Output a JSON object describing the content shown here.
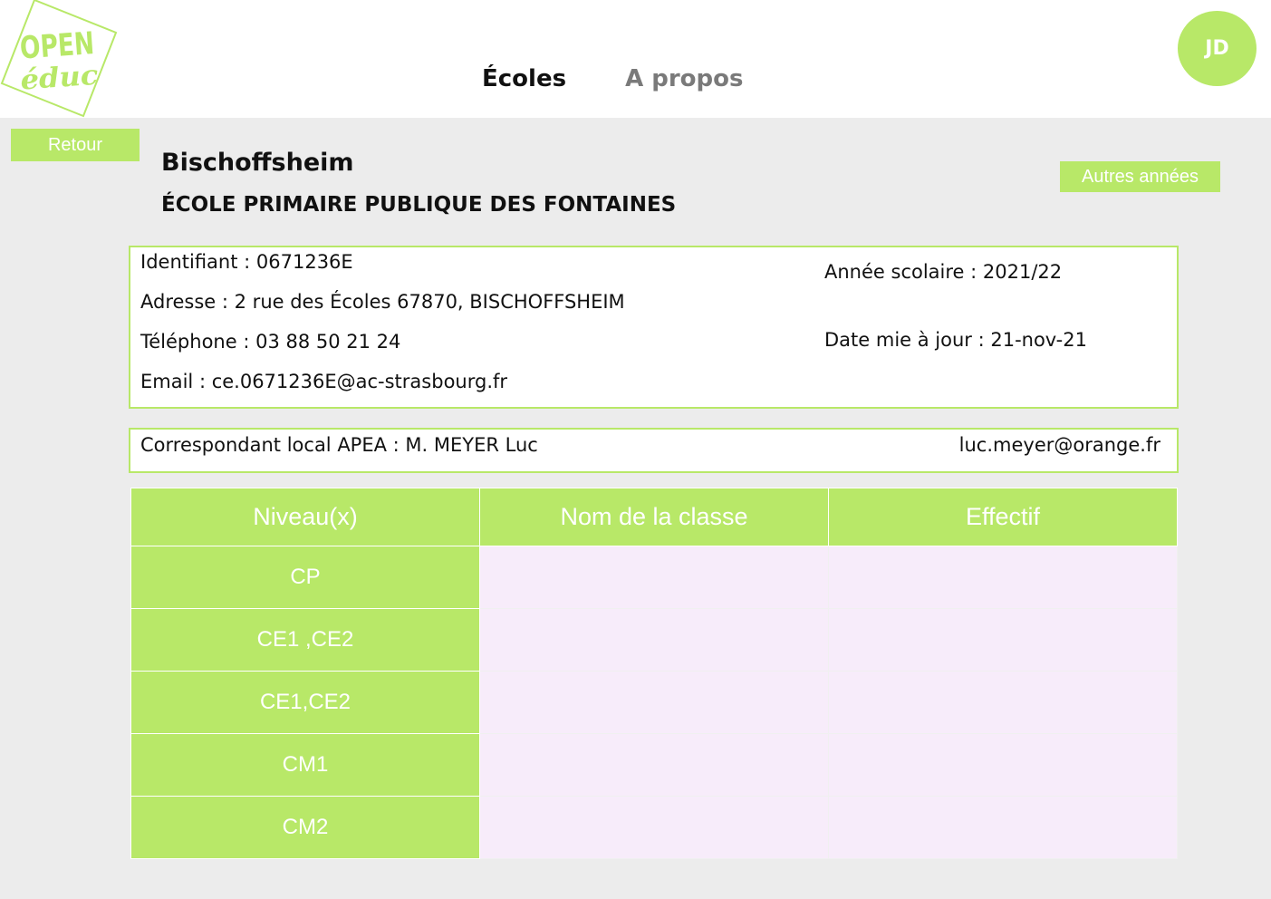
{
  "header": {
    "logo": {
      "line1": "OPEN",
      "line2": "éduc",
      "color": "#b8e868"
    },
    "tabs": [
      {
        "label": "Écoles",
        "active": true
      },
      {
        "label": "A propos",
        "active": false
      }
    ],
    "avatar_initials": "JD"
  },
  "actions": {
    "back_label": "Retour",
    "other_years_label": "Autres années"
  },
  "school": {
    "city": "Bischoffsheim",
    "name": "ÉCOLE PRIMAIRE PUBLIQUE DES FONTAINES"
  },
  "info": {
    "identifiant": "Identifiant : 0671236E",
    "adresse": "Adresse : 2 rue des Écoles 67870, BISCHOFFSHEIM",
    "telephone": "Téléphone : 03 88 50 21 24",
    "email": "Email : ce.0671236E@ac-strasbourg.fr",
    "annee": "Année scolaire : 2021/22",
    "date_maj": "Date mie à jour : 21-nov-21"
  },
  "apea": {
    "correspondant": "Correspondant local APEA : M. MEYER Luc",
    "email": "luc.meyer@orange.fr"
  },
  "table": {
    "headers": [
      "Niveau(x)",
      "Nom de la classe",
      "Effectif"
    ],
    "rows": [
      {
        "niveau": "CP",
        "nom": "",
        "effectif": ""
      },
      {
        "niveau": "CE1 ,CE2",
        "nom": "",
        "effectif": ""
      },
      {
        "niveau": "CE1,CE2",
        "nom": "",
        "effectif": ""
      },
      {
        "niveau": "CM1",
        "nom": "",
        "effectif": ""
      },
      {
        "niveau": "CM2",
        "nom": "",
        "effectif": ""
      }
    ]
  },
  "colors": {
    "accent": "#b8e868",
    "background": "#ececec",
    "empty_cell": "#f7ecfa"
  }
}
